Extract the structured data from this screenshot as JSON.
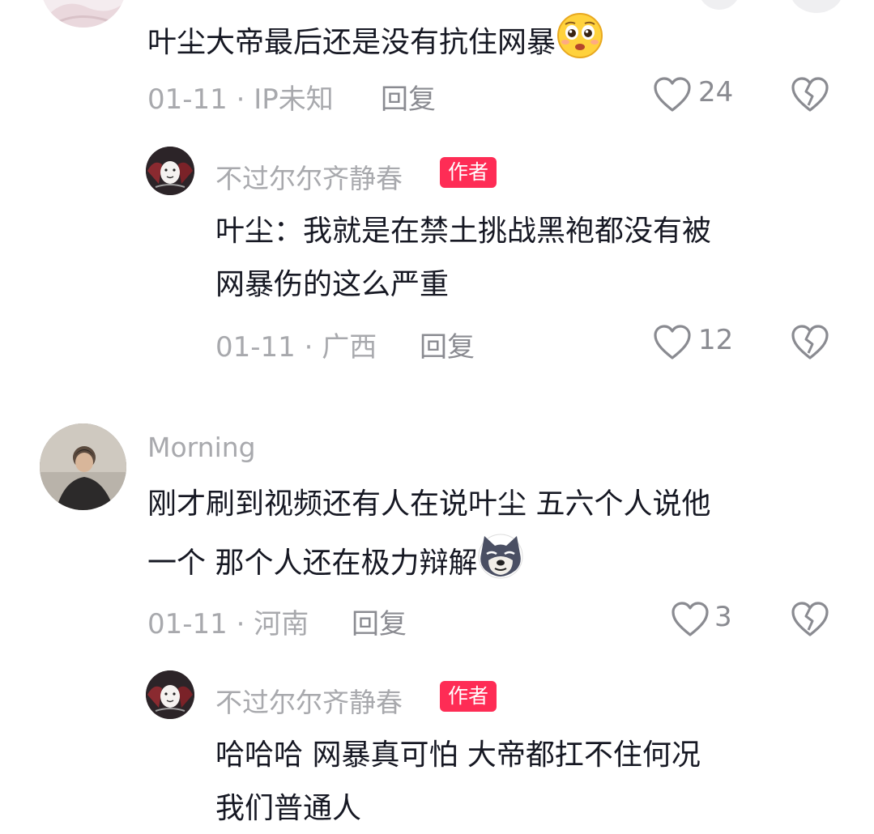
{
  "comments": [
    {
      "text": "叶尘大帝最后还是没有抗住网暴",
      "emoji": "pleading-face-icon",
      "date_location": "01-11 · IP未知",
      "reply_label": "回复",
      "likes": "24",
      "reply": {
        "author": "不过尔尔齐静春",
        "badge": "作者",
        "text_line1": "叶尘：我就是在禁土挑战黑袍都没有被",
        "text_line2": "网暴伤的这么严重",
        "date_location": "01-11 · 广西",
        "reply_label": "回复",
        "likes": "12"
      }
    },
    {
      "author": "Morning",
      "text_line1": "刚才刷到视频还有人在说叶尘 五六个人说他",
      "text_line2": "一个 那个人还在极力辩解",
      "emoji": "doge-icon",
      "date_location": "01-11 · 河南",
      "reply_label": "回复",
      "likes": "3",
      "reply": {
        "author": "不过尔尔齐静春",
        "badge": "作者",
        "text_line1": "哈哈哈  网暴真可怕 大帝都扛不住何况",
        "text_line2": "我们普通人"
      }
    }
  ],
  "colors": {
    "accent": "#fe2c55",
    "text": "#161823",
    "muted": "#a8a9ad"
  }
}
